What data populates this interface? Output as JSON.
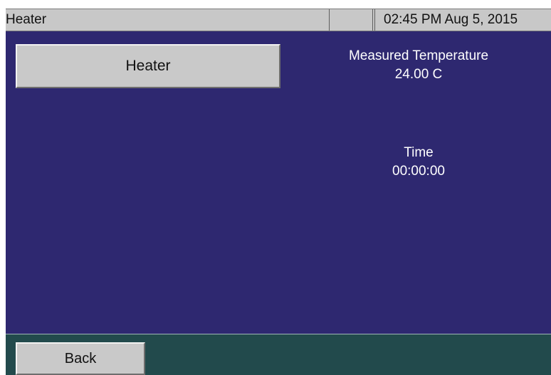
{
  "titlebar": {
    "title": "Heater",
    "status": "",
    "datetime": "02:45 PM Aug 5, 2015"
  },
  "main": {
    "heater_button_label": "Heater",
    "temperature": {
      "label": "Measured Temperature",
      "value": "24.00 C"
    },
    "time": {
      "label": "Time",
      "value": "00:00:00"
    }
  },
  "footer": {
    "back_label": "Back"
  },
  "colors": {
    "main_background": "#2e2870",
    "footer_background": "#224a4c",
    "titlebar_background": "#c8c8c8",
    "button_face": "#c9c9c9",
    "readout_text": "#ffffff"
  }
}
